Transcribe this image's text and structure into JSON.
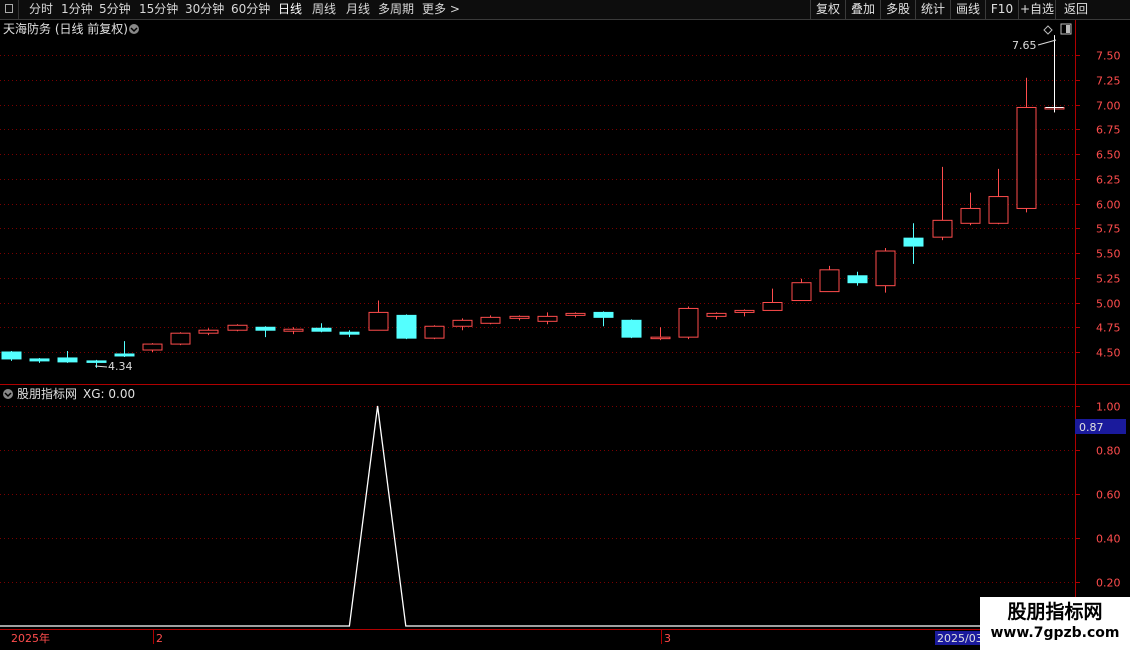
{
  "toolbar": {
    "periods": [
      "分时",
      "1分钟",
      "5分钟",
      "15分钟",
      "30分钟",
      "60分钟",
      "日线",
      "周线",
      "月线",
      "多周期",
      "更多 >"
    ],
    "active_period": "日线",
    "buttons": [
      "复权",
      "叠加",
      "多股",
      "统计",
      "画线",
      "F10",
      "+自选",
      "返回"
    ]
  },
  "main_chart": {
    "stock_title": "天海防务 (日线 前复权)",
    "price_ticks": [
      "7.50",
      "7.25",
      "7.00",
      "6.75",
      "6.50",
      "6.25",
      "6.00",
      "5.75",
      "5.50",
      "5.25",
      "5.00",
      "4.75",
      "4.50"
    ],
    "high_marker": "7.65",
    "low_marker": "4.34"
  },
  "indicator": {
    "title": "股朋指标网",
    "xg_label": "XG: 0.00",
    "ticks": [
      "1.00",
      "0.80",
      "0.60",
      "0.40",
      "0.20"
    ],
    "cursor_value": "0.87",
    "values": [
      0,
      0,
      0,
      0,
      0,
      0,
      0,
      0,
      0,
      0,
      0,
      0,
      0,
      1,
      0,
      0,
      0,
      0,
      0,
      0,
      0,
      0,
      0,
      0,
      0,
      0,
      0,
      0,
      0,
      0,
      0,
      0,
      0,
      0,
      0,
      0,
      0,
      0
    ]
  },
  "time_axis": {
    "labels": [
      "2025年",
      "2",
      "3"
    ],
    "cursor_date": "2025/03/"
  },
  "watermark": {
    "title": "股朋指标网",
    "url": "www.7gpzb.com"
  },
  "colors": {
    "up": "#ff4d4d",
    "down": "#54ffff",
    "grid": "#7a0000",
    "indicator_line": "#ffffff",
    "cursor_box": "#1a1a9c"
  },
  "chart_data": {
    "type": "candlestick",
    "title": "天海防务 (日线 前复权)",
    "ylim": [
      4.3,
      7.75
    ],
    "candles": [
      {
        "o": 4.5,
        "h": 4.51,
        "l": 4.41,
        "c": 4.43
      },
      {
        "o": 4.43,
        "h": 4.44,
        "l": 4.39,
        "c": 4.41
      },
      {
        "o": 4.44,
        "h": 4.51,
        "l": 4.39,
        "c": 4.4
      },
      {
        "o": 4.41,
        "h": 4.42,
        "l": 4.34,
        "c": 4.4
      },
      {
        "o": 4.48,
        "h": 4.61,
        "l": 4.45,
        "c": 4.46
      },
      {
        "o": 4.52,
        "h": 4.59,
        "l": 4.5,
        "c": 4.58
      },
      {
        "o": 4.58,
        "h": 4.7,
        "l": 4.57,
        "c": 4.69
      },
      {
        "o": 4.69,
        "h": 4.74,
        "l": 4.67,
        "c": 4.72
      },
      {
        "o": 4.72,
        "h": 4.78,
        "l": 4.71,
        "c": 4.77
      },
      {
        "o": 4.75,
        "h": 4.76,
        "l": 4.65,
        "c": 4.72
      },
      {
        "o": 4.71,
        "h": 4.75,
        "l": 4.68,
        "c": 4.73
      },
      {
        "o": 4.74,
        "h": 4.79,
        "l": 4.7,
        "c": 4.71
      },
      {
        "o": 4.7,
        "h": 4.72,
        "l": 4.65,
        "c": 4.68
      },
      {
        "o": 4.72,
        "h": 5.02,
        "l": 4.72,
        "c": 4.9
      },
      {
        "o": 4.87,
        "h": 4.88,
        "l": 4.63,
        "c": 4.64
      },
      {
        "o": 4.64,
        "h": 4.77,
        "l": 4.63,
        "c": 4.76
      },
      {
        "o": 4.76,
        "h": 4.84,
        "l": 4.72,
        "c": 4.82
      },
      {
        "o": 4.79,
        "h": 4.87,
        "l": 4.78,
        "c": 4.85
      },
      {
        "o": 4.84,
        "h": 4.87,
        "l": 4.82,
        "c": 4.86
      },
      {
        "o": 4.81,
        "h": 4.9,
        "l": 4.78,
        "c": 4.86
      },
      {
        "o": 4.87,
        "h": 4.9,
        "l": 4.85,
        "c": 4.89
      },
      {
        "o": 4.9,
        "h": 4.91,
        "l": 4.76,
        "c": 4.85
      },
      {
        "o": 4.82,
        "h": 4.83,
        "l": 4.64,
        "c": 4.65
      },
      {
        "o": 4.65,
        "h": 4.75,
        "l": 4.62,
        "c": 4.65
      },
      {
        "o": 4.65,
        "h": 4.96,
        "l": 4.63,
        "c": 4.94
      },
      {
        "o": 4.86,
        "h": 4.9,
        "l": 4.83,
        "c": 4.89
      },
      {
        "o": 4.9,
        "h": 4.93,
        "l": 4.86,
        "c": 4.92
      },
      {
        "o": 4.92,
        "h": 5.14,
        "l": 4.92,
        "c": 5.0
      },
      {
        "o": 5.02,
        "h": 5.24,
        "l": 5.02,
        "c": 5.2
      },
      {
        "o": 5.11,
        "h": 5.37,
        "l": 5.11,
        "c": 5.33
      },
      {
        "o": 5.27,
        "h": 5.31,
        "l": 5.17,
        "c": 5.2
      },
      {
        "o": 5.17,
        "h": 5.55,
        "l": 5.1,
        "c": 5.52
      },
      {
        "o": 5.65,
        "h": 5.8,
        "l": 5.39,
        "c": 5.57
      },
      {
        "o": 5.66,
        "h": 6.37,
        "l": 5.63,
        "c": 5.83
      },
      {
        "o": 5.8,
        "h": 6.11,
        "l": 5.78,
        "c": 5.95
      },
      {
        "o": 5.8,
        "h": 6.35,
        "l": 5.79,
        "c": 6.07
      },
      {
        "o": 5.95,
        "h": 7.27,
        "l": 5.91,
        "c": 6.97
      },
      {
        "o": 6.97,
        "h": 7.65,
        "l": 6.92,
        "c": 6.97
      }
    ]
  }
}
